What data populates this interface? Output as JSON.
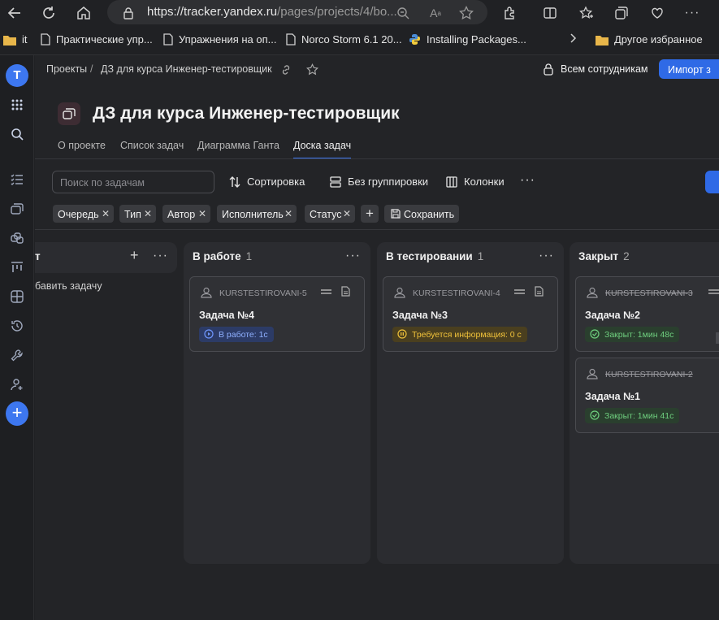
{
  "browser": {
    "url_host": "https://tracker.yandex.ru",
    "url_path": "/pages/projects/4/bo...",
    "bookmarks": [
      "it",
      "Практические упр...",
      "Упражнения на оп...",
      "Norco Storm 6.1 20...",
      "Installing Packages...",
      "Другое избранное"
    ]
  },
  "breadcrumb": {
    "root": "Проекты",
    "separator": "/",
    "current": "ДЗ для курса Инженер-тестировщик"
  },
  "access_label": "Всем сотрудникам",
  "import_label": "Импорт з",
  "page_title": "ДЗ для курса Инженер-тестировщик",
  "tabs": [
    "О проекте",
    "Список задач",
    "Диаграмма Ганта",
    "Доска задач"
  ],
  "active_tab": "Доска задач",
  "search_placeholder": "Поиск по задачам",
  "toolbar": {
    "sort": "Сортировка",
    "group": "Без группировки",
    "columns": "Колонки"
  },
  "filters": [
    "Очередь",
    "Тип",
    "Автор",
    "Исполнитель",
    "Статус"
  ],
  "save_label": "Сохранить",
  "board": {
    "left_column": {
      "title_fragment": "т",
      "add_task": "бавить задачу"
    },
    "columns": [
      {
        "title": "В работе",
        "count": "1",
        "cards": [
          {
            "key": "KURSTESTIROVANI-5",
            "title": "Задача №4",
            "status": "В работе: 1с",
            "tone": "blue",
            "closed": false
          }
        ]
      },
      {
        "title": "В тестировании",
        "count": "1",
        "cards": [
          {
            "key": "KURSTESTIROVANI-4",
            "title": "Задача №3",
            "status": "Требуется информация: 0 с",
            "tone": "yellow",
            "closed": false
          }
        ]
      },
      {
        "title": "Закрыт",
        "count": "2",
        "cards": [
          {
            "key": "KURSTESTIROVANI-3",
            "title": "Задача №2",
            "status": "Закрыт: 1мин 48с",
            "tone": "green",
            "closed": true
          },
          {
            "key": "KURSTESTIROVANI-2",
            "title": "Задача №1",
            "status": "Закрыт: 1мин 41с",
            "tone": "green",
            "closed": true
          }
        ]
      }
    ]
  },
  "colors": {
    "accent": "#2f6ae6",
    "background": "#232427",
    "column_bg": "#2b2c30",
    "card_bg": "#303135"
  }
}
